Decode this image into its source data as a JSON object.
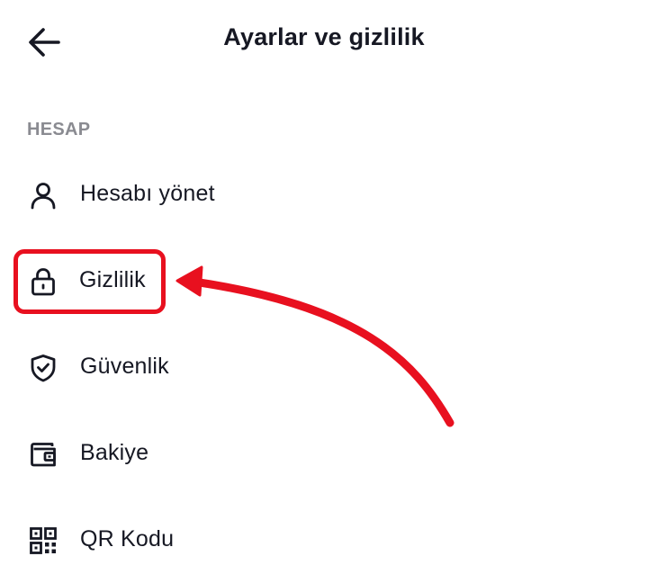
{
  "header": {
    "title": "Ayarlar ve gizlilik",
    "back_icon": "arrow-left-icon"
  },
  "section": {
    "title": "HESAP"
  },
  "menu": {
    "items": [
      {
        "label": "Hesabı yönet",
        "icon": "user-icon"
      },
      {
        "label": "Gizlilik",
        "icon": "lock-icon"
      },
      {
        "label": "Güvenlik",
        "icon": "shield-check-icon"
      },
      {
        "label": "Bakiye",
        "icon": "wallet-icon"
      },
      {
        "label": "QR Kodu",
        "icon": "qr-code-icon"
      }
    ]
  },
  "annotation": {
    "color": "#e8101f",
    "highlighted_item": "Gizlilik"
  }
}
